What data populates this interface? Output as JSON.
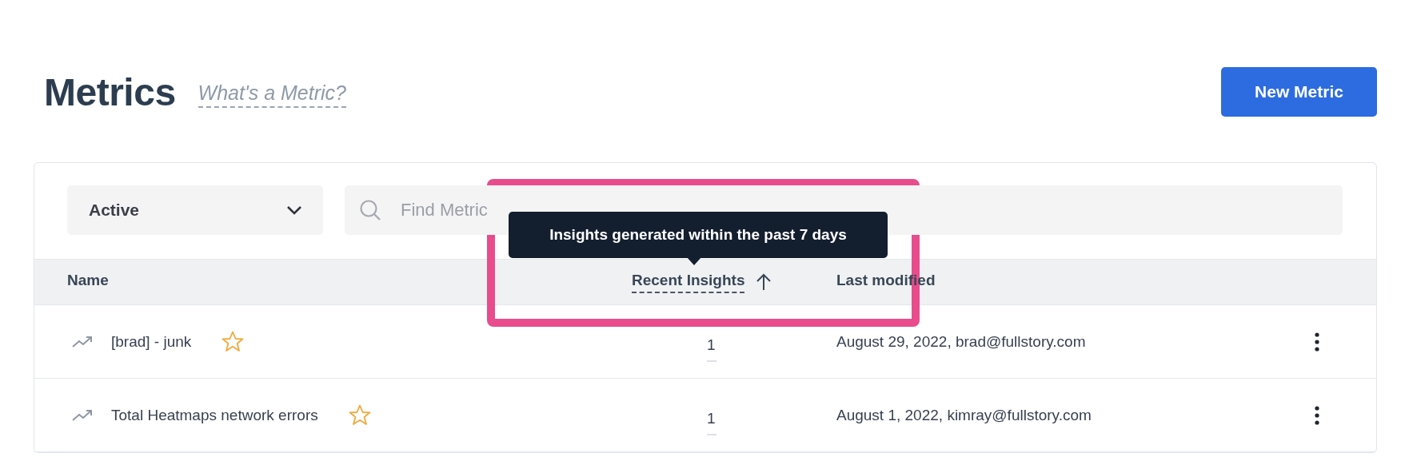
{
  "page": {
    "title": "Metrics",
    "help_link": "What's a Metric?",
    "primary_button": "New Metric"
  },
  "filters": {
    "status": {
      "value": "Active"
    },
    "search": {
      "placeholder": "Find Metric"
    }
  },
  "tooltip": {
    "text": "Insights generated within the past 7 days"
  },
  "table": {
    "columns": [
      {
        "label": "Name",
        "sorted": false,
        "underlined": false
      },
      {
        "label": "Recent Insights",
        "sorted": true,
        "underlined": true
      },
      {
        "label": "Last modified",
        "sorted": false,
        "underlined": false
      }
    ],
    "rows": [
      {
        "name": "[brad] - junk",
        "starred": false,
        "recent_insights": "1",
        "last_modified": "August 29, 2022, brad@fullstory.com"
      },
      {
        "name": "Total Heatmaps network errors",
        "starred": false,
        "recent_insights": "1",
        "last_modified": "August 1, 2022, kimray@fullstory.com"
      }
    ]
  }
}
